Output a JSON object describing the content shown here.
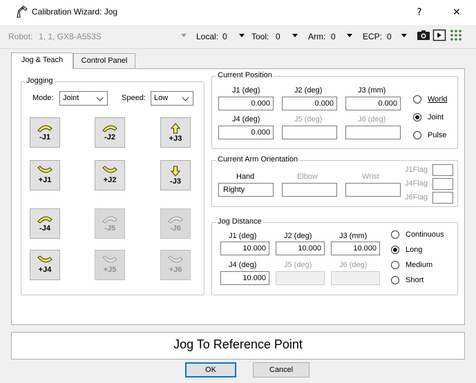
{
  "window": {
    "title": "Calibration Wizard: Jog",
    "help_label": "?",
    "close_label": "✕",
    "icon": "robot-arm-icon"
  },
  "toolbar": {
    "robot_label": "Robot:",
    "robot_value": "1, 1, GX8-A553S",
    "local_label": "Local:",
    "local_value": "0",
    "tool_label": "Tool:",
    "tool_value": "0",
    "arm_label": "Arm:",
    "arm_value": "0",
    "ecp_label": "ECP:",
    "ecp_value": "0",
    "icons": [
      "camera-icon",
      "run-icon",
      "io-grid-icon"
    ]
  },
  "tabs": [
    {
      "label": "Jog & Teach",
      "active": true
    },
    {
      "label": "Control Panel",
      "active": false
    }
  ],
  "jogging": {
    "group_title": "Jogging",
    "mode_label": "Mode:",
    "mode_value": "Joint",
    "speed_label": "Speed:",
    "speed_value": "Low",
    "buttons": [
      {
        "label": "-J1",
        "enabled": true
      },
      {
        "label": "-J2",
        "enabled": true
      },
      {
        "label": "+J3",
        "enabled": true
      },
      {
        "label": "+J1",
        "enabled": true
      },
      {
        "label": "+J2",
        "enabled": true
      },
      {
        "label": "-J3",
        "enabled": true
      },
      {
        "label": "-J4",
        "enabled": true
      },
      {
        "label": "-J5",
        "enabled": false
      },
      {
        "label": "-J6",
        "enabled": false
      },
      {
        "label": "+J4",
        "enabled": true
      },
      {
        "label": "+J5",
        "enabled": false
      },
      {
        "label": "+J6",
        "enabled": false
      }
    ]
  },
  "current_position": {
    "group_title": "Current Position",
    "labels": [
      "J1 (deg)",
      "J2 (deg)",
      "J3 (mm)",
      "J4 (deg)",
      "J5 (deg)",
      "J6 (deg)"
    ],
    "values": [
      "0.000",
      "0.000",
      "0.000",
      "0.000",
      "",
      ""
    ],
    "options": [
      {
        "label": "World",
        "selected": false
      },
      {
        "label": "Joint",
        "selected": true
      },
      {
        "label": "Pulse",
        "selected": false
      }
    ]
  },
  "arm_orientation": {
    "group_title": "Current Arm Orientation",
    "hand_label": "Hand",
    "hand_value": "Righty",
    "elbow_label": "Elbow",
    "elbow_value": "",
    "wrist_label": "Wrist",
    "wrist_value": "",
    "flags": [
      "J1Flag",
      "J4Flag",
      "J6Flag"
    ]
  },
  "jog_distance": {
    "group_title": "Jog Distance",
    "labels": [
      "J1 (deg)",
      "J2 (deg)",
      "J3 (mm)",
      "J4 (deg)",
      "J5 (deg)",
      "J6 (deg)"
    ],
    "values": [
      "10.000",
      "10.000",
      "10.000",
      "10.000",
      "",
      ""
    ],
    "options": [
      {
        "label": "Continuous",
        "selected": false
      },
      {
        "label": "Long",
        "selected": true
      },
      {
        "label": "Medium",
        "selected": false
      },
      {
        "label": "Short",
        "selected": false
      }
    ]
  },
  "footer": {
    "reference_text": "Jog To Reference Point",
    "ok_label": "OK",
    "cancel_label": "Cancel"
  }
}
